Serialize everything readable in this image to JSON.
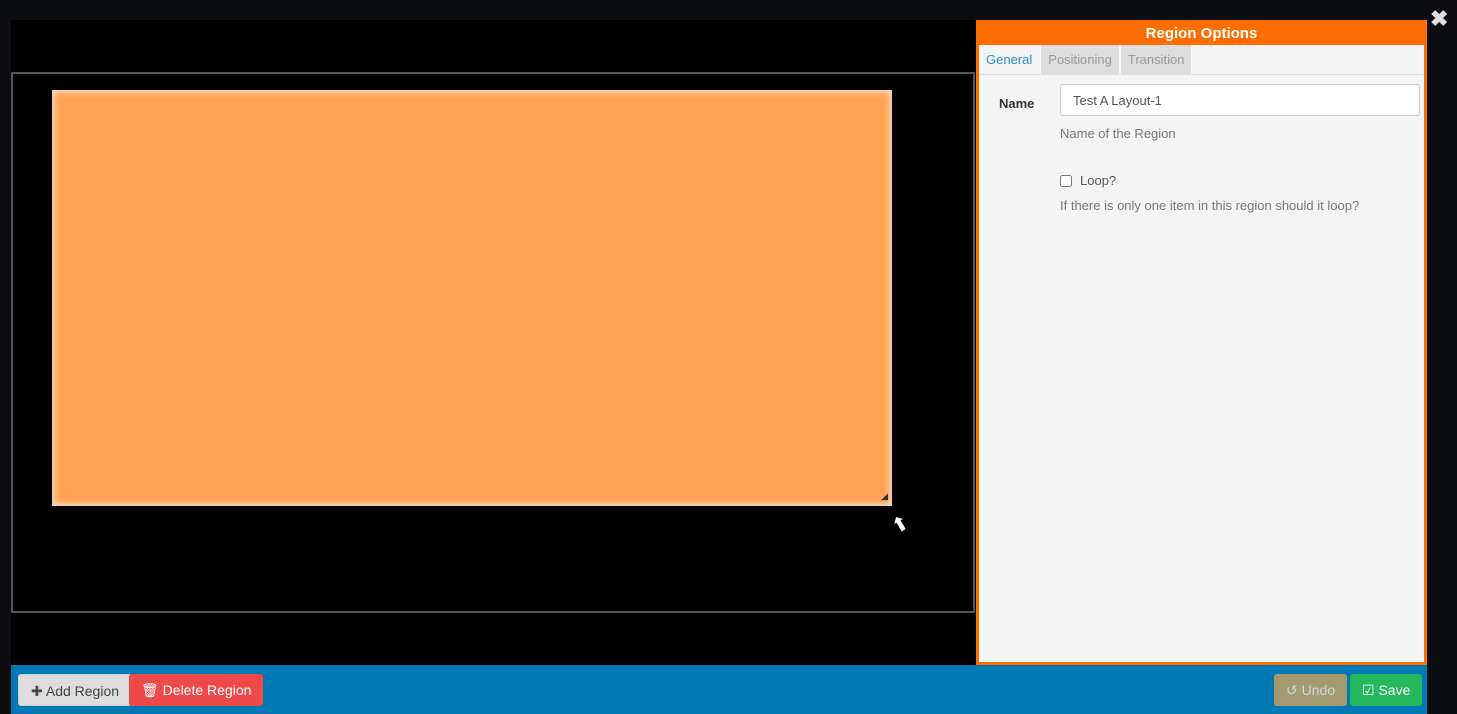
{
  "panel": {
    "title": "Region Options",
    "tabs": [
      {
        "label": "General",
        "active": true
      },
      {
        "label": "Positioning"
      },
      {
        "label": "Transition"
      }
    ],
    "name_label": "Name",
    "name_value": "Test A Layout-1",
    "name_help": "Name of the Region",
    "loop_label": "Loop?",
    "loop_checked": false,
    "loop_help": "If there is only one item in this region should it loop?"
  },
  "footer": {
    "add_region": "Add Region",
    "delete_region": "Delete Region",
    "undo": "Undo",
    "save": "Save"
  },
  "colors": {
    "accent": "#ff6c00",
    "region": "#ffa252",
    "footer": "#0079b5",
    "delete": "#ef4a4a",
    "save": "#23b75e"
  },
  "icons": {
    "close": "close-icon",
    "add": "plus-icon",
    "delete": "trash-icon",
    "undo": "undo-icon",
    "save": "check-square-icon"
  }
}
